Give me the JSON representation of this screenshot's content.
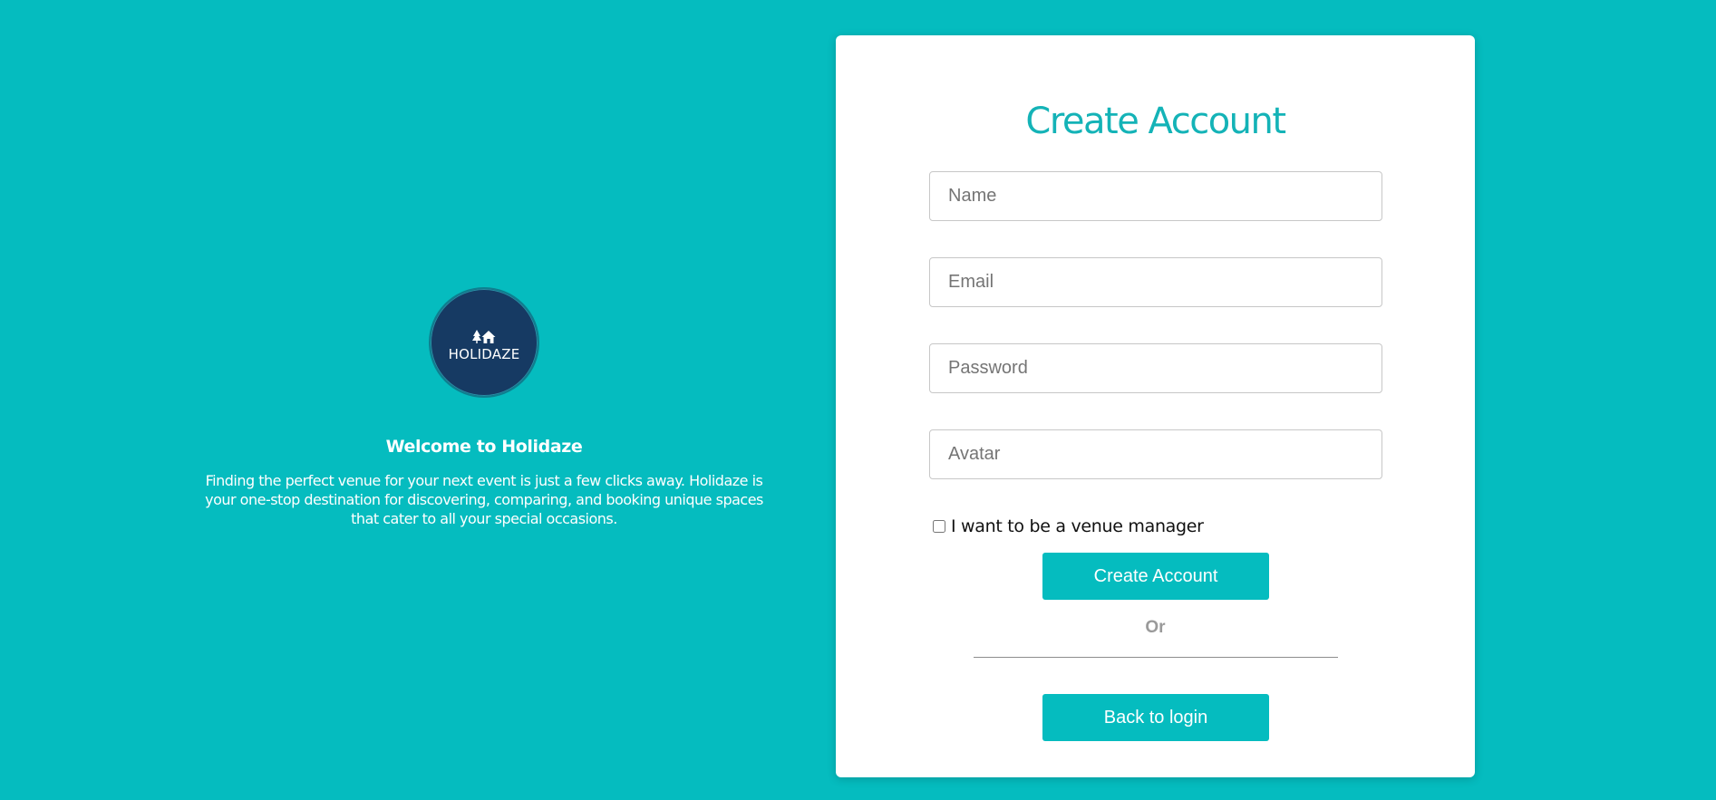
{
  "welcome": {
    "logo_text": "HOLIDAZE",
    "logo_icon": "trees-house-icon",
    "title": "Welcome to Holidaze",
    "description": "Finding the perfect venue for your next event is just a few clicks away. Holidaze is your one-stop destination for discovering, comparing, and booking unique spaces that cater to all your special occasions."
  },
  "form": {
    "title": "Create Account",
    "fields": {
      "name": {
        "placeholder": "Name",
        "value": ""
      },
      "email": {
        "placeholder": "Email",
        "value": ""
      },
      "password": {
        "placeholder": "Password",
        "value": ""
      },
      "avatar": {
        "placeholder": "Avatar",
        "value": ""
      }
    },
    "venue_manager": {
      "label": "I want to be a venue manager",
      "checked": false
    },
    "submit_label": "Create Account",
    "or_text": "Or",
    "back_label": "Back to login"
  },
  "colors": {
    "background": "#05bcbf",
    "accent": "#05bcbf",
    "title": "#14b3b7",
    "logo_bg": "#163a63",
    "card": "#ffffff"
  }
}
